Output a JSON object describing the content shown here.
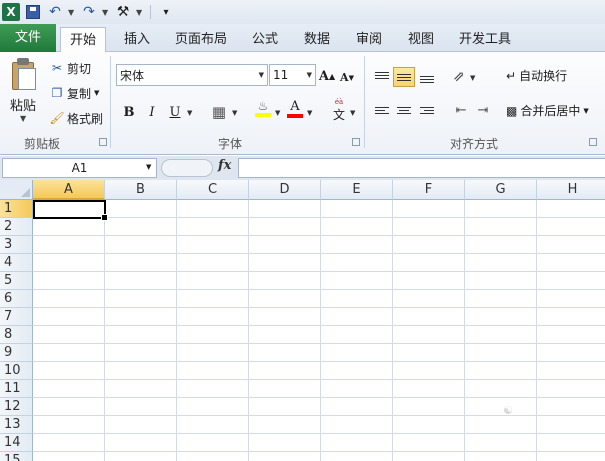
{
  "quick_access": {
    "app_logo": "X",
    "icons": [
      "excel-icon",
      "save-icon",
      "undo-icon",
      "redo-icon",
      "customize-icon"
    ]
  },
  "tabs": [
    {
      "label": "文件",
      "name": "tab-file"
    },
    {
      "label": "开始",
      "name": "tab-home",
      "active": true
    },
    {
      "label": "插入",
      "name": "tab-insert"
    },
    {
      "label": "页面布局",
      "name": "tab-page-layout"
    },
    {
      "label": "公式",
      "name": "tab-formulas"
    },
    {
      "label": "数据",
      "name": "tab-data"
    },
    {
      "label": "审阅",
      "name": "tab-review"
    },
    {
      "label": "视图",
      "name": "tab-view"
    },
    {
      "label": "开发工具",
      "name": "tab-developer"
    }
  ],
  "ribbon": {
    "clipboard": {
      "paste_label": "粘贴",
      "cut_label": "剪切",
      "copy_label": "复制",
      "format_painter_label": "格式刷",
      "group_label": "剪贴板"
    },
    "font": {
      "font_name": "宋体",
      "font_size": "11",
      "bold": "B",
      "italic": "I",
      "underline": "U",
      "font_color_glyph": "A",
      "phonetic_glyph": "文",
      "grow_glyph": "A",
      "shrink_glyph": "A",
      "group_label": "字体"
    },
    "alignment": {
      "wrap_text_label": "自动换行",
      "merge_center_label": "合并后居中",
      "group_label": "对齐方式"
    }
  },
  "formula_bar": {
    "name_box": "A1",
    "fx_label": "fx",
    "formula": ""
  },
  "sheet": {
    "columns": [
      "A",
      "B",
      "C",
      "D",
      "E",
      "F",
      "G",
      "H"
    ],
    "rows": [
      "1",
      "2",
      "3",
      "4",
      "5",
      "6",
      "7",
      "8",
      "9",
      "10",
      "11",
      "12",
      "13",
      "14",
      "15"
    ],
    "active_cell": "A1"
  },
  "colors": {
    "file_tab": "#1f7a3a",
    "selected_header": "#f5c957",
    "highlight_fill": "#ffff00",
    "font_color": "#ff0000"
  }
}
